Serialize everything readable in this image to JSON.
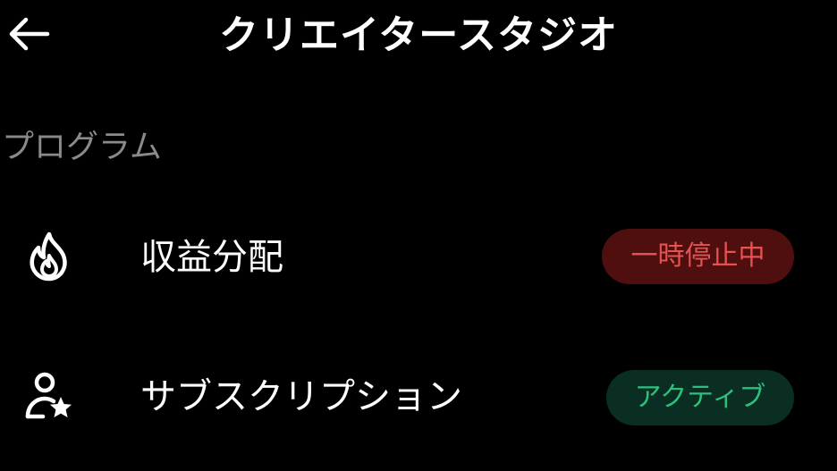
{
  "header": {
    "title": "クリエイタースタジオ",
    "back_icon": "arrow-left-icon"
  },
  "section": {
    "label": "プログラム"
  },
  "items": [
    {
      "icon": "flame-icon",
      "label": "収益分配",
      "status": "一時停止中",
      "status_color": "#e65151",
      "status_bg": "#4f0f0f"
    },
    {
      "icon": "user-star-icon",
      "label": "サブスクリプション",
      "status": "アクティブ",
      "status_color": "#2fbf7d",
      "status_bg": "#0a2e21"
    }
  ]
}
